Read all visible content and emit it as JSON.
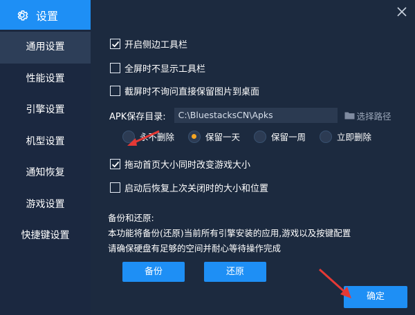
{
  "window": {
    "title": "设置",
    "close_icon": "close-icon",
    "gear_icon": "gear-icon"
  },
  "sidebar": {
    "items": [
      {
        "label": "通用设置",
        "active": true
      },
      {
        "label": "性能设置",
        "active": false
      },
      {
        "label": "引擎设置",
        "active": false
      },
      {
        "label": "机型设置",
        "active": false
      },
      {
        "label": "通知恢复",
        "active": false
      },
      {
        "label": "游戏设置",
        "active": false
      },
      {
        "label": "快捷键设置",
        "active": false
      }
    ]
  },
  "general": {
    "side_toolbar": {
      "label": "开启侧边工具栏",
      "checked": true
    },
    "fullscreen_toolbar": {
      "label": "全屏时不显示工具栏",
      "checked": false
    },
    "screenshot_desktop": {
      "label": "截屏时不询问直接保留图片到桌面",
      "checked": false
    },
    "apk": {
      "label": "APK保存目录:",
      "path": "C:\\BluestacksCN\\Apks",
      "browse_label": "选择路径"
    },
    "retention_options": [
      {
        "label": "永不删除",
        "selected": false
      },
      {
        "label": "保留一天",
        "selected": true
      },
      {
        "label": "保留一周",
        "selected": false
      },
      {
        "label": "立即删除",
        "selected": false
      }
    ],
    "resize_game": {
      "label": "拖动首页大小同时改变游戏大小",
      "checked": true
    },
    "restore_size": {
      "label": "启动后恢复上次关闭时的大小和位置",
      "checked": false
    }
  },
  "backup": {
    "title": "备份和还原:",
    "desc1": "本功能将备份(还原)当前所有引擎安装的应用,游戏以及按键配置",
    "desc2": "请确保硬盘有足够的空间并耐心等待操作完成",
    "backup_label": "备份",
    "restore_label": "还原"
  },
  "footer": {
    "ok_label": "确定"
  },
  "colors": {
    "accent": "#1e8ff5",
    "background": "#1c2a3f",
    "radio_selected": "#f5a623",
    "arrow": "#e53935"
  }
}
